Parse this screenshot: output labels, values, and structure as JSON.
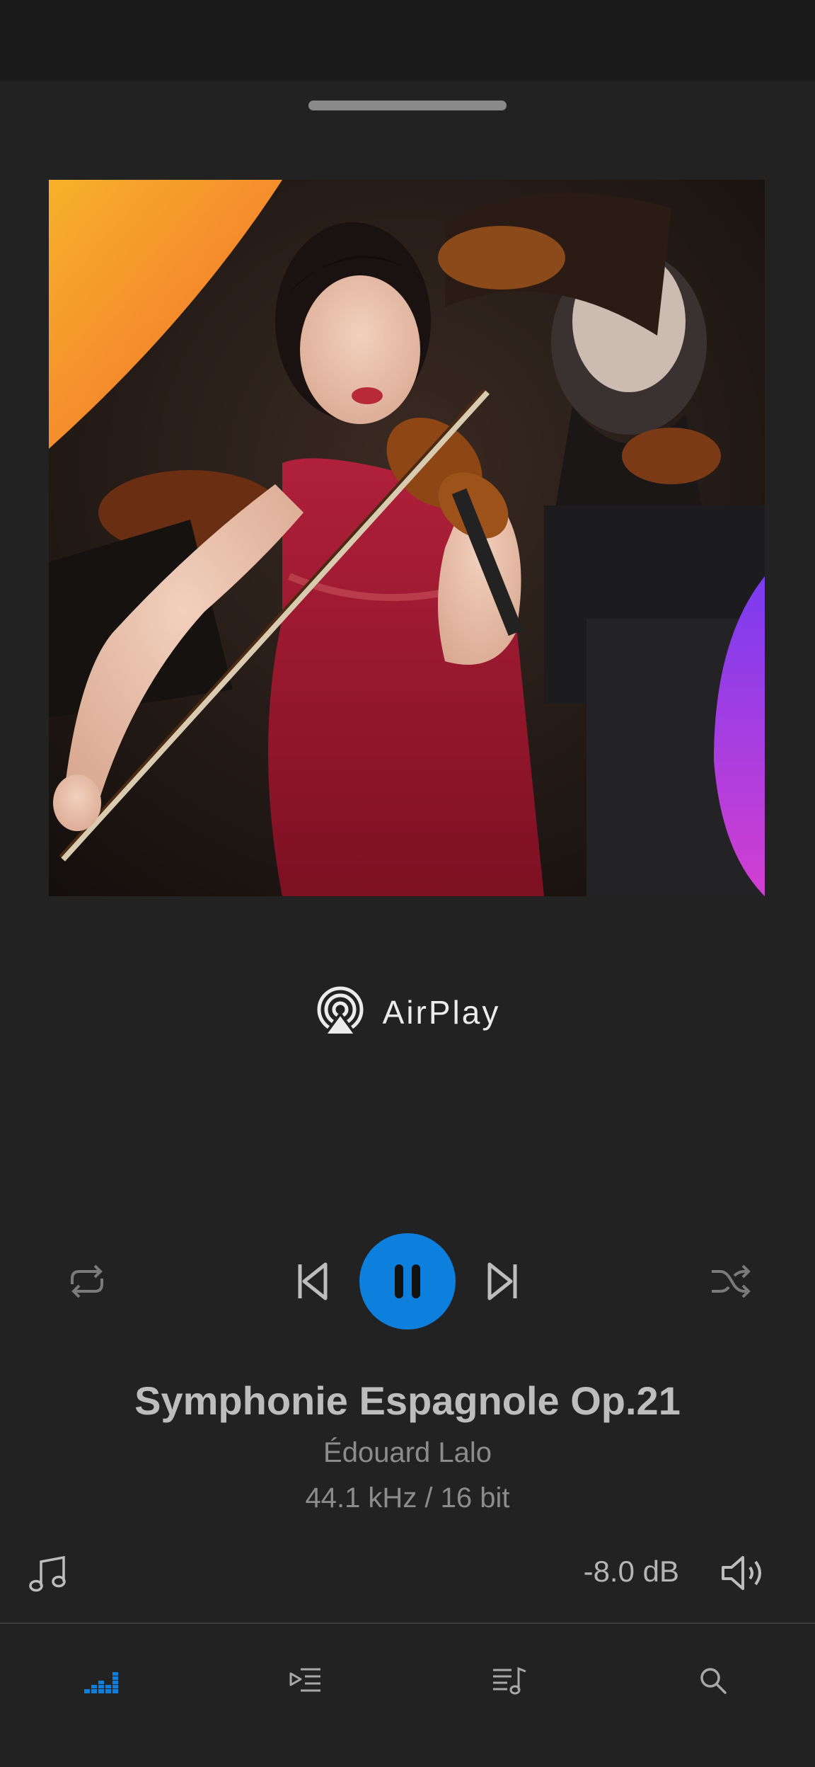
{
  "airplay": {
    "label": "AirPlay",
    "icon": "airplay-icon"
  },
  "controls": {
    "repeat_icon": "repeat-icon",
    "previous_icon": "skip-previous-icon",
    "play_state_icon": "pause-icon",
    "next_icon": "skip-next-icon",
    "shuffle_icon": "shuffle-icon",
    "accent_color": "#0d7fdc"
  },
  "track": {
    "title": "Symphonie Espagnole Op.21",
    "artist": "Édouard Lalo",
    "format": "44.1 kHz / 16 bit"
  },
  "volume": {
    "level": "-8.0 dB",
    "icon": "speaker-icon"
  },
  "library_icon": "music-note-icon",
  "bottom_nav": [
    {
      "name": "now-playing",
      "icon": "equalizer-icon",
      "active": true
    },
    {
      "name": "queue",
      "icon": "play-queue-icon",
      "active": false
    },
    {
      "name": "library",
      "icon": "music-library-icon",
      "active": false
    },
    {
      "name": "search",
      "icon": "search-icon",
      "active": false
    }
  ]
}
